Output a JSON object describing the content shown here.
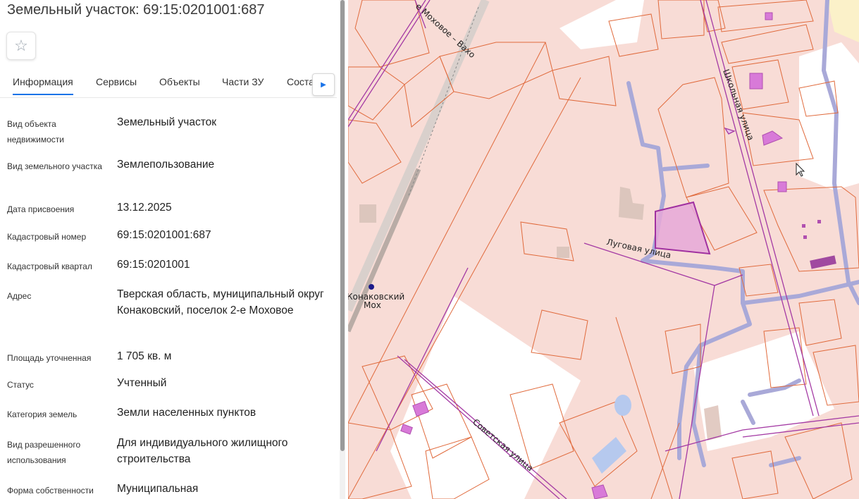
{
  "title": "Земельный участок: 69:15:0201001:687",
  "tabs": [
    "Информация",
    "Сервисы",
    "Объекты",
    "Части ЗУ",
    "Соста"
  ],
  "rows": [
    {
      "label": "Вид объекта недвижимости",
      "value": "Земельный участок"
    },
    {
      "label": "Вид земельного участка",
      "value": "Землепользование"
    },
    {
      "label": "Дата присвоения",
      "value": "13.12.2025"
    },
    {
      "label": "Кадастровый номер",
      "value": "69:15:0201001:687"
    },
    {
      "label": "Кадастровый квартал",
      "value": "69:15:0201001"
    },
    {
      "label": "Адрес",
      "value": "Тверская область, муниципальный округ Конаковский, поселок 2-е Моховое"
    },
    {
      "label": "Площадь уточненная",
      "value": "1 705 кв. м"
    },
    {
      "label": "Статус",
      "value": "Учтенный"
    },
    {
      "label": "Категория земель",
      "value": "Земли населенных пунктов"
    },
    {
      "label": "Вид разрешенного использования",
      "value": "Для индивидуального жилищного строительства"
    },
    {
      "label": "Форма собственности",
      "value": "Муниципальная"
    }
  ],
  "map": {
    "streets": {
      "lugovaya": "Луговая улица",
      "shkolnaya": "Школьная улица",
      "sovetskaya": "Советская улица",
      "mokhovoe": "е Моховое – Вахо"
    },
    "station": [
      "Конаковский",
      "Мох"
    ]
  },
  "colors": {
    "accent": "#1a73e8",
    "parcel_line": "#e06a3c",
    "highlight": "#c040c0",
    "map_bg": "#f8dcd6"
  },
  "icons": {
    "favorite": "star-icon",
    "next": "chevron-right-icon"
  }
}
